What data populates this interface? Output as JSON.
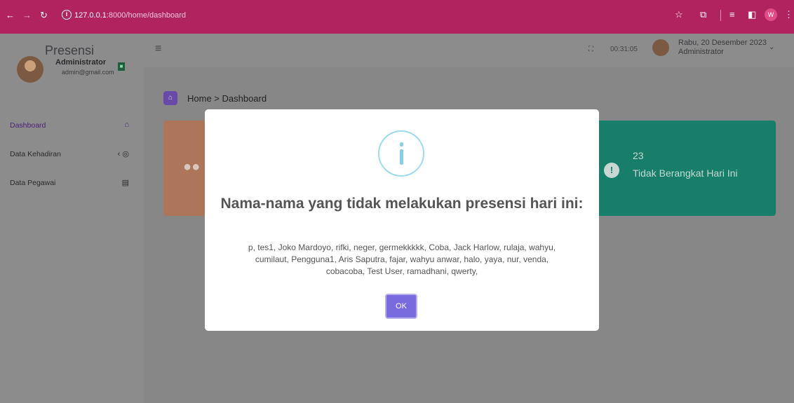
{
  "browser": {
    "url_host": "127.0.0.1",
    "url_rest": ":8000/home/dashboard",
    "profile_initial": "W"
  },
  "app": {
    "brand": "Presensi",
    "profile": {
      "name": "Administrator",
      "email": "admin@gmail.com"
    },
    "sidebar": {
      "items": [
        {
          "label": "Dashboard",
          "icon": "home-icon"
        },
        {
          "label": "Data Kehadiran",
          "icon": "target-icon"
        },
        {
          "label": "Data Pegawai",
          "icon": "id-card-icon"
        }
      ]
    },
    "topbar": {
      "clock": "00:31:05",
      "date": "Rabu, 20 Desember 2023",
      "role": "Administrator"
    },
    "breadcrumb": "Home > Dashboard",
    "cards": {
      "absent_count": "23",
      "absent_label": "Tidak Berangkat Hari Ini"
    }
  },
  "modal": {
    "title": "Nama-nama yang tidak melakukan presensi hari ini:",
    "body": "p, tes1, Joko Mardoyo, rifki, neger, germekkkkk, Coba, Jack Harlow, rulaja, wahyu, cumilaut, Pengguna1, Aris Saputra, fajar, wahyu anwar, halo, yaya, nur, venda, cobacoba, Test User, ramadhani, qwerty,",
    "ok_label": "OK"
  }
}
